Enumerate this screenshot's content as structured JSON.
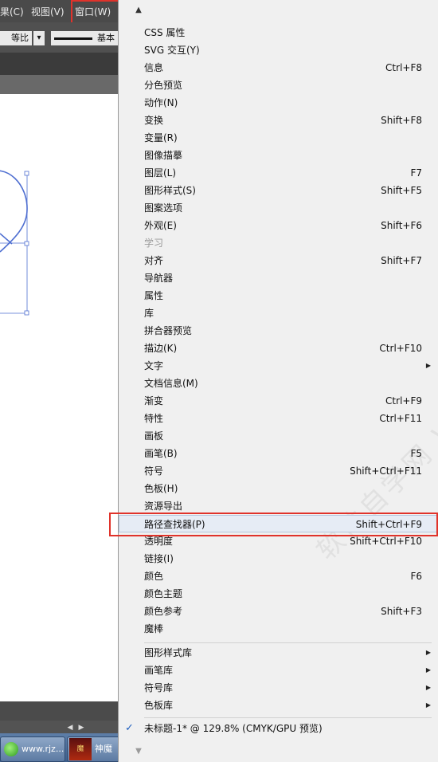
{
  "menubar": {
    "effects": "果(C)",
    "view": "视图(V)",
    "window": "窗口(W)"
  },
  "control_bar": {
    "equal_ratio": "等比",
    "stroke_style": "基本"
  },
  "taskbar": {
    "browser_label": "www.rjz...",
    "game_label": "神魔"
  },
  "menu": {
    "items_group1": [
      {
        "label": "CSS 属性",
        "shortcut": ""
      },
      {
        "label": "SVG 交互(Y)",
        "shortcut": ""
      },
      {
        "label": "信息",
        "shortcut": "Ctrl+F8"
      },
      {
        "label": "分色预览",
        "shortcut": ""
      },
      {
        "label": "动作(N)",
        "shortcut": ""
      },
      {
        "label": "变换",
        "shortcut": "Shift+F8"
      },
      {
        "label": "变量(R)",
        "shortcut": ""
      },
      {
        "label": "图像描摹",
        "shortcut": ""
      },
      {
        "label": "图层(L)",
        "shortcut": "F7"
      },
      {
        "label": "图形样式(S)",
        "shortcut": "Shift+F5"
      },
      {
        "label": "图案选项",
        "shortcut": ""
      },
      {
        "label": "外观(E)",
        "shortcut": "Shift+F6"
      },
      {
        "label": "学习",
        "shortcut": "",
        "disabled": true
      },
      {
        "label": "对齐",
        "shortcut": "Shift+F7"
      },
      {
        "label": "导航器",
        "shortcut": ""
      },
      {
        "label": "属性",
        "shortcut": ""
      },
      {
        "label": "库",
        "shortcut": ""
      },
      {
        "label": "拼合器预览",
        "shortcut": ""
      },
      {
        "label": "描边(K)",
        "shortcut": "Ctrl+F10"
      },
      {
        "label": "文字",
        "shortcut": "",
        "submenu": true
      },
      {
        "label": "文档信息(M)",
        "shortcut": ""
      },
      {
        "label": "渐变",
        "shortcut": "Ctrl+F9"
      },
      {
        "label": "特性",
        "shortcut": "Ctrl+F11"
      },
      {
        "label": "画板",
        "shortcut": ""
      },
      {
        "label": "画笔(B)",
        "shortcut": "F5"
      },
      {
        "label": "符号",
        "shortcut": "Shift+Ctrl+F11"
      },
      {
        "label": "色板(H)",
        "shortcut": ""
      },
      {
        "label": "资源导出",
        "shortcut": ""
      },
      {
        "label": "路径查找器(P)",
        "shortcut": "Shift+Ctrl+F9",
        "highlight": true
      },
      {
        "label": "透明度",
        "shortcut": "Shift+Ctrl+F10"
      },
      {
        "label": "链接(I)",
        "shortcut": ""
      },
      {
        "label": "颜色",
        "shortcut": "F6"
      },
      {
        "label": "颜色主题",
        "shortcut": ""
      },
      {
        "label": "颜色参考",
        "shortcut": "Shift+F3"
      },
      {
        "label": "魔棒",
        "shortcut": ""
      }
    ],
    "items_group2": [
      {
        "label": "图形样式库",
        "submenu": true
      },
      {
        "label": "画笔库",
        "submenu": true
      },
      {
        "label": "符号库",
        "submenu": true
      },
      {
        "label": "色板库",
        "submenu": true
      }
    ],
    "document_item": "未标题-1* @ 129.8% (CMYK/GPU 预览)",
    "watermark": "软件自学网 WWW.RJZXW.COM"
  }
}
